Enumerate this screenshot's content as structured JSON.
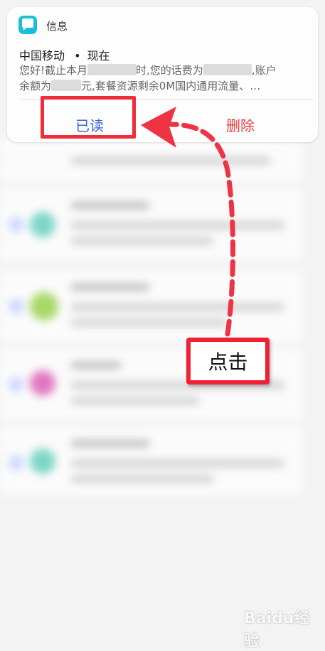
{
  "notification": {
    "app_name": "信息",
    "sender": "中国移动",
    "separator": "•",
    "time": "现在",
    "body_line1_a": "您好!截止本月",
    "body_line1_b": "时,您的话费为",
    "body_line1_c": ",账户",
    "body_line2_a": "余额为",
    "body_line2_b": "元,套餐资源剩余0M国内通用流量、…",
    "actions": {
      "read": "已读",
      "delete": "删除"
    }
  },
  "annotation": {
    "tap_label": "点击",
    "accent_color": "#ee2233"
  },
  "watermark": "Baidu经验"
}
